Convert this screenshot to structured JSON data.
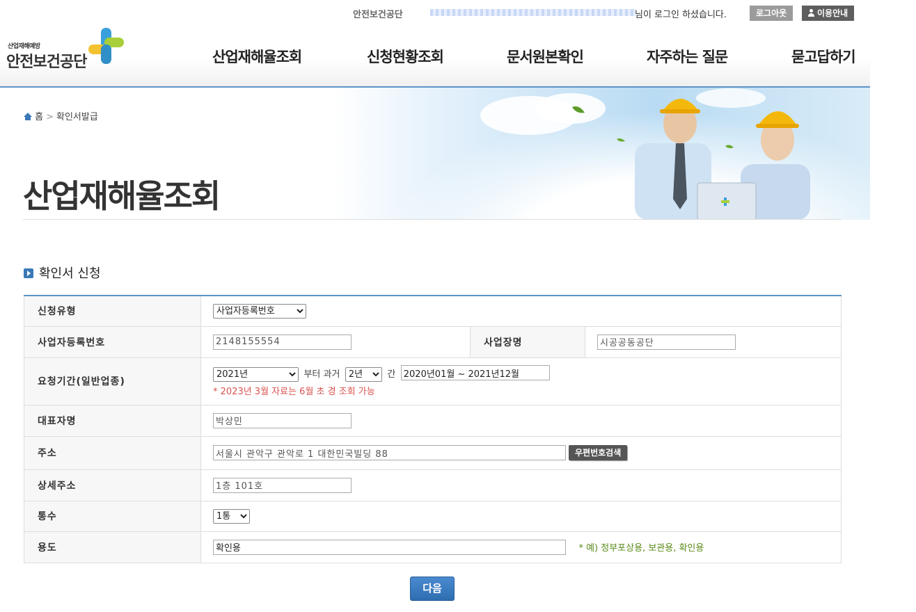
{
  "topbar": {
    "org": "안전보건공단",
    "greeting": "님이 로그인 하셨습니다.",
    "logout": "로그아웃",
    "guide": "이용안내"
  },
  "logo": {
    "small": "산업재해예방",
    "big": "안전보건공단"
  },
  "nav": [
    "산업재해율조회",
    "신청현황조회",
    "문서원본확인",
    "자주하는 질문",
    "묻고답하기"
  ],
  "breadcrumb": {
    "home": "홈",
    "current": "확인서발급"
  },
  "page_title": "산업재해율조회",
  "section_title": "확인서 신청",
  "form": {
    "apply_type": {
      "label": "신청유형",
      "value": "사업자등록번호"
    },
    "biz_no": {
      "label": "사업자등록번호",
      "value": "2148155554"
    },
    "biz_name": {
      "label": "사업장명",
      "value": "시공공동공단"
    },
    "period": {
      "label": "요청기간(일반업종)",
      "year": "2021년",
      "from_text": "부터 과거",
      "years": "2년",
      "gan": "간",
      "range": "2020년01월 ~ 2021년12월",
      "note": "* 2023년 3월 자료는 6월 초 경 조회 가능"
    },
    "rep_name": {
      "label": "대표자명",
      "value": "박상민"
    },
    "address": {
      "label": "주소",
      "value": "서울시 관악구 관악로 1 대한민국빌딩 88",
      "zip_button": "우편번호검색"
    },
    "detail_address": {
      "label": "상세주소",
      "value": "1층 101호"
    },
    "copies": {
      "label": "통수",
      "value": "1통"
    },
    "purpose": {
      "label": "용도",
      "value": "확인용",
      "note": "* 예) 정부포상용, 보관용, 확인용"
    }
  },
  "next_button": "다음",
  "colors": {
    "accent": "#3a79b7",
    "rule": "#5b93c7",
    "note_red": "#d9534f",
    "note_green": "#5a8a1a"
  }
}
